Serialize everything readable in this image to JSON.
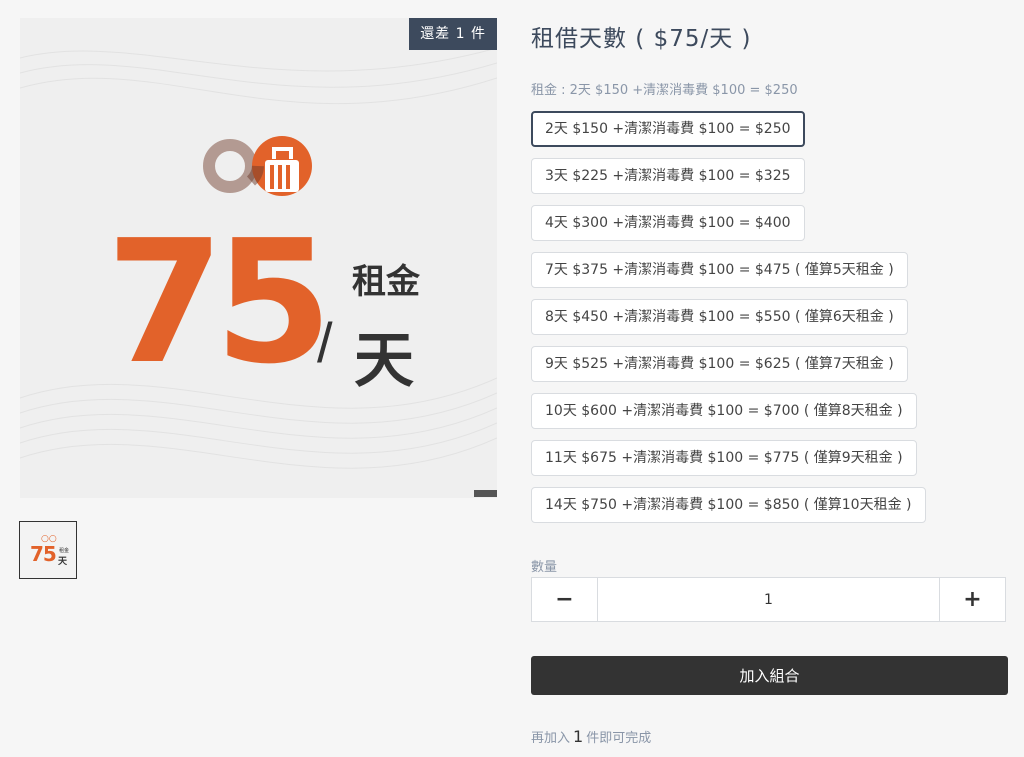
{
  "product_image": {
    "remaining_badge": "還差 1 件",
    "big_number": "75",
    "slash": "/",
    "unit_top": "租金",
    "unit_bottom": "天",
    "logo_icon": "luggage-logo-icon"
  },
  "thumbnail": {
    "number": "75",
    "unit": "天",
    "unit_small": "租金",
    "logo": "○○"
  },
  "title": "租借天數 ( $75/天 )",
  "subtitle": "租金 : 2天 $150 +清潔消毒費 $100 = $250",
  "options": [
    {
      "label": "2天 $150 +清潔消毒費 $100 = $250",
      "selected": true
    },
    {
      "label": "3天 $225 +清潔消毒費 $100 = $325",
      "selected": false
    },
    {
      "label": "4天 $300 +清潔消毒費 $100 = $400",
      "selected": false
    },
    {
      "label": "7天 $375 +清潔消毒費 $100 = $475 ( 僅算5天租金 )",
      "selected": false
    },
    {
      "label": "8天 $450 +清潔消毒費 $100 = $550 ( 僅算6天租金 )",
      "selected": false
    },
    {
      "label": "9天 $525 +清潔消毒費 $100 = $625 ( 僅算7天租金 )",
      "selected": false
    },
    {
      "label": "10天 $600 +清潔消毒費 $100 = $700 ( 僅算8天租金 )",
      "selected": false
    },
    {
      "label": "11天 $675 +清潔消毒費 $100 = $775 ( 僅算9天租金 )",
      "selected": false
    },
    {
      "label": "14天 $750 +清潔消毒費 $100 = $850 ( 僅算10天租金 )",
      "selected": false
    }
  ],
  "quantity": {
    "label": "數量",
    "minus": "−",
    "plus": "+",
    "value": "1"
  },
  "add_button": "加入組合",
  "footer": {
    "prefix": "再加入",
    "count": "1",
    "suffix": "件即可完成"
  },
  "colors": {
    "accent_orange": "#e2622a",
    "navy": "#3d4a5d",
    "button_dark": "#333333"
  }
}
